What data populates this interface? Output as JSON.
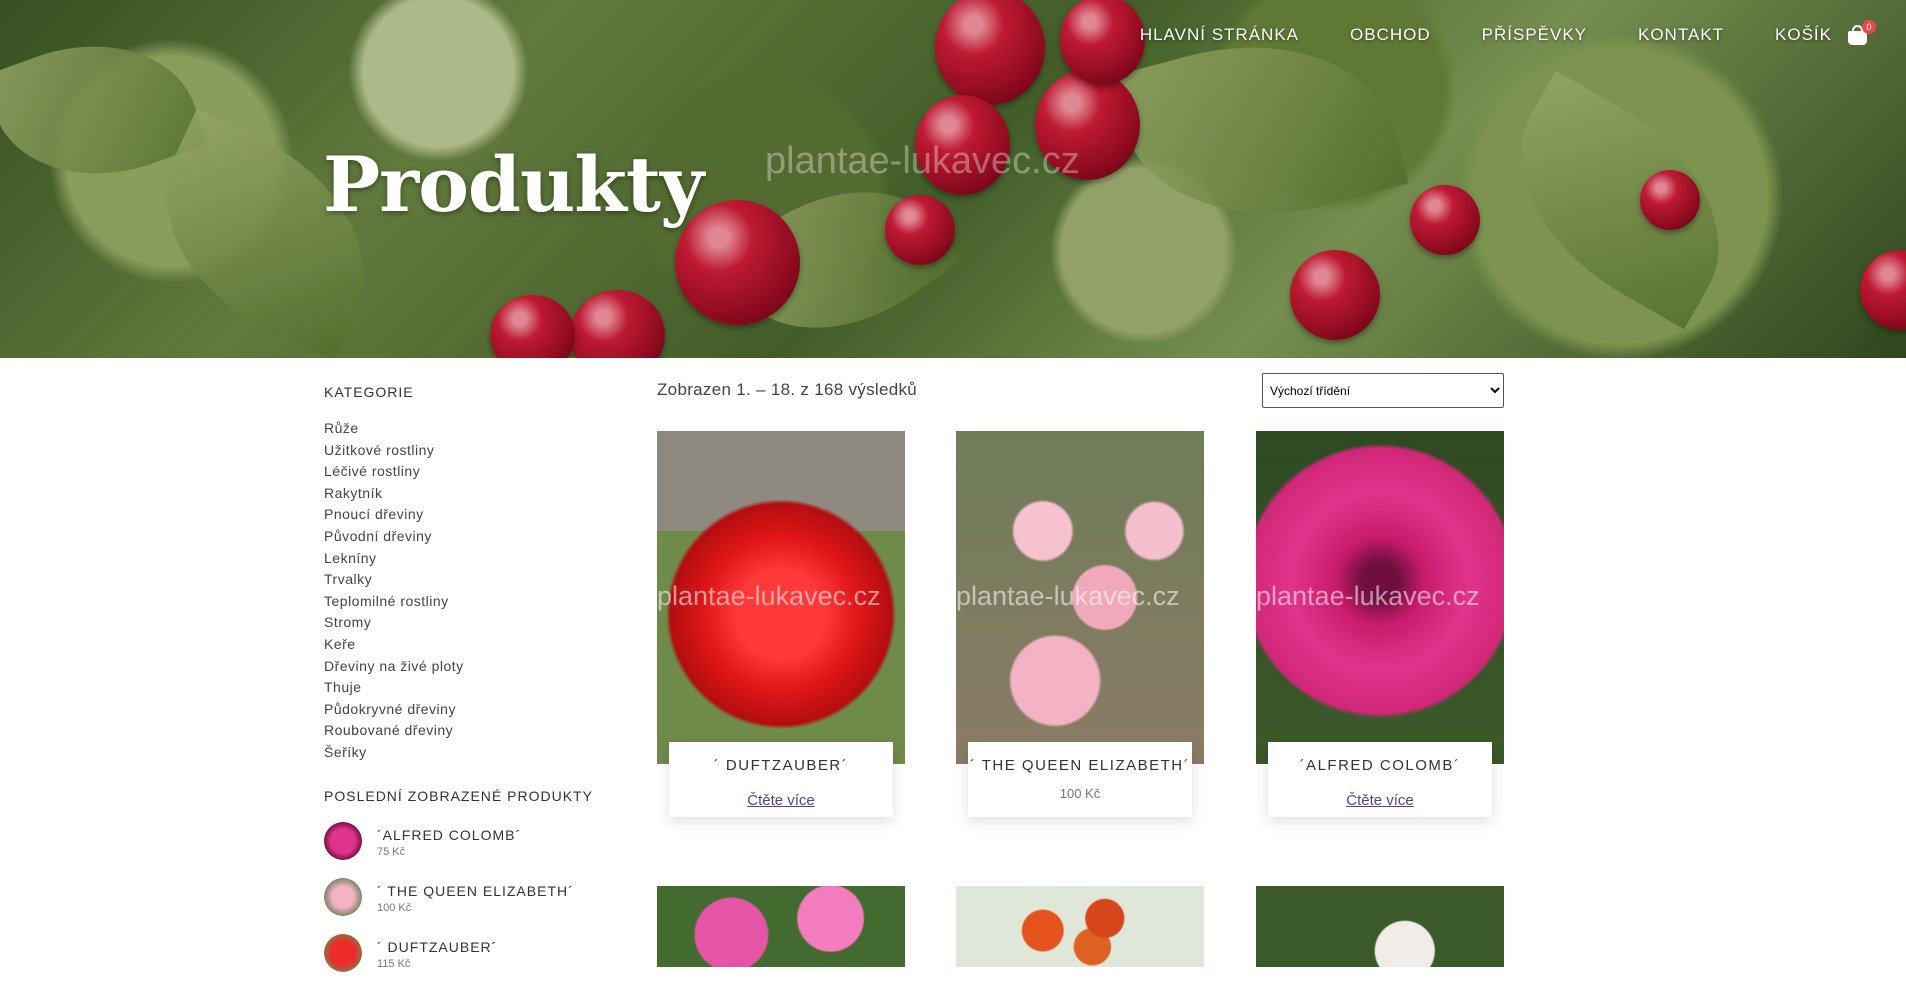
{
  "nav": {
    "items": [
      "HLAVNÍ STRÁNKA",
      "OBCHOD",
      "PŘÍSPĚVKY",
      "KONTAKT",
      "KOŠÍK"
    ],
    "cart_count": "0"
  },
  "hero": {
    "title": "Produkty",
    "watermark": "plantae-lukavec.cz"
  },
  "sidebar": {
    "categories_heading": "KATEGORIE",
    "categories": [
      "Růže",
      "Užitkové rostliny",
      "Léčivé rostliny",
      "Rakytník",
      "Pnoucí dřeviny",
      "Původní dřeviny",
      "Lekníny",
      "Trvalky",
      "Teplomilné rostliny",
      "Stromy",
      "Keře",
      "Dřeviny na živé ploty",
      "Thuje",
      "Půdokryvné dřeviny",
      "Roubované dřeviny",
      "Šeříky"
    ],
    "recent_heading": "POSLEDNÍ ZOBRAZENÉ PRODUKTY",
    "recent": [
      {
        "name": "´ALFRED COLOMB´",
        "price": "75 Kč"
      },
      {
        "name": "´ THE QUEEN ELIZABETH´",
        "price": "100 Kč"
      },
      {
        "name": "´ DUFTZAUBER´",
        "price": "115 Kč"
      }
    ]
  },
  "shop": {
    "result_count": "Zobrazen 1. – 18. z 168 výsledků",
    "sort_selected": "Výchozí třídění",
    "products": [
      {
        "name": "´ DUFTZAUBER´",
        "link": "Čtěte více",
        "watermark": "plantae-lukavec.cz"
      },
      {
        "name": "´ THE QUEEN ELIZABETH´",
        "price": "100 Kč",
        "watermark": "plantae-lukavec.cz"
      },
      {
        "name": "´ALFRED COLOMB´",
        "link": "Čtěte více",
        "watermark": "plantae-lukavec.cz"
      }
    ]
  }
}
